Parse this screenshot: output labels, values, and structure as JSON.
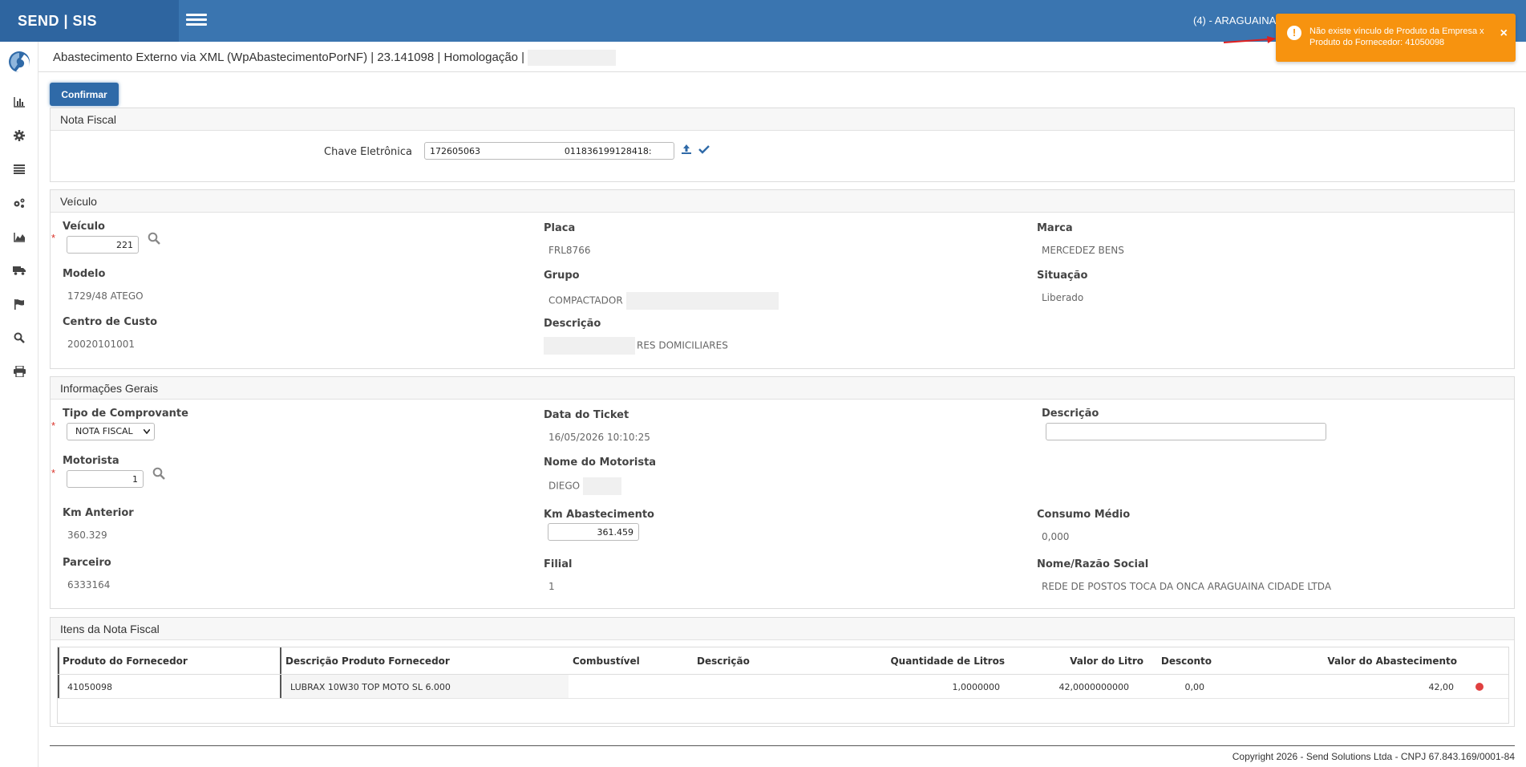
{
  "app": {
    "brand": "SEND | SIS",
    "company": "(4) - ARAGUAINA"
  },
  "header": {
    "title": "Abastecimento Externo via XML (WpAbastecimentoPorNF) | 23.141098 | Homologação |"
  },
  "toolbar": {
    "confirm_label": "Confirmar"
  },
  "toast": {
    "message": "Não existe vínculo de Produto da Empresa x Produto do Fornecedor: 41050098",
    "close": "×",
    "color": "#f7930f"
  },
  "sidebar": {
    "icons": [
      "chart-bar-icon",
      "gear-icon",
      "list-icon",
      "cogs-icon",
      "area-chart-icon",
      "truck-icon",
      "flag-icon",
      "search-icon",
      "print-icon"
    ]
  },
  "nota_fiscal": {
    "title": "Nota Fiscal",
    "chave_label": "Chave Eletrônica",
    "chave_value": "172605063                              011836199128418:"
  },
  "veiculo": {
    "title": "Veículo",
    "veiculo_label": "Veículo",
    "veiculo_value": "221",
    "placa_label": "Placa",
    "placa_value": "FRL8766",
    "marca_label": "Marca",
    "marca_value": "MERCEDEZ BENS",
    "modelo_label": "Modelo",
    "modelo_value": "1729/48 ATEGO",
    "grupo_label": "Grupo",
    "grupo_value": "COMPACTADOR",
    "situacao_label": "Situação",
    "situacao_value": "Liberado",
    "centro_label": "Centro de Custo",
    "centro_value": "20020101001",
    "descricao_label": "Descrição",
    "descricao_value": "RES DOMICILIARES"
  },
  "info": {
    "title": "Informações Gerais",
    "tipo_label": "Tipo de Comprovante",
    "tipo_value": "NOTA FISCAL",
    "data_label": "Data do Ticket",
    "data_value": "16/05/2026 10:10:25",
    "descricao_label": "Descrição",
    "descricao_value": "",
    "motorista_label": "Motorista",
    "motorista_value": "1",
    "nome_motorista_label": "Nome do Motorista",
    "nome_motorista_value": "DIEGO",
    "km_anterior_label": "Km Anterior",
    "km_anterior_value": "360.329",
    "km_abast_label": "Km Abastecimento",
    "km_abast_value": "361.459",
    "consumo_label": "Consumo Médio",
    "consumo_value": "0,000",
    "parceiro_label": "Parceiro",
    "parceiro_value": "6333164",
    "filial_label": "Filial",
    "filial_value": "1",
    "razao_label": "Nome/Razão Social",
    "razao_value": "REDE DE POSTOS TOCA DA ONCA ARAGUAINA CIDADE LTDA"
  },
  "itens": {
    "title": "Itens da Nota Fiscal",
    "columns": [
      "Produto do Fornecedor",
      "Descrição Produto Fornecedor",
      "Combustível",
      "Descrição",
      "Quantidade de Litros",
      "Valor do Litro",
      "Desconto",
      "Valor do Abastecimento"
    ],
    "rows": [
      {
        "produto": "41050098",
        "descricao_prod": "LUBRAX 10W30 TOP MOTO SL 6.000",
        "combustivel": "",
        "descricao": "",
        "quantidade": "1,0000000",
        "valor_litro": "42,0000000000",
        "desconto": "0,00",
        "valor_abast": "42,00",
        "status_color": "#e04040"
      }
    ]
  },
  "footer": {
    "copyright": "Copyright 2026 - Send Solutions Ltda - CNPJ 67.843.169/0001-84"
  }
}
